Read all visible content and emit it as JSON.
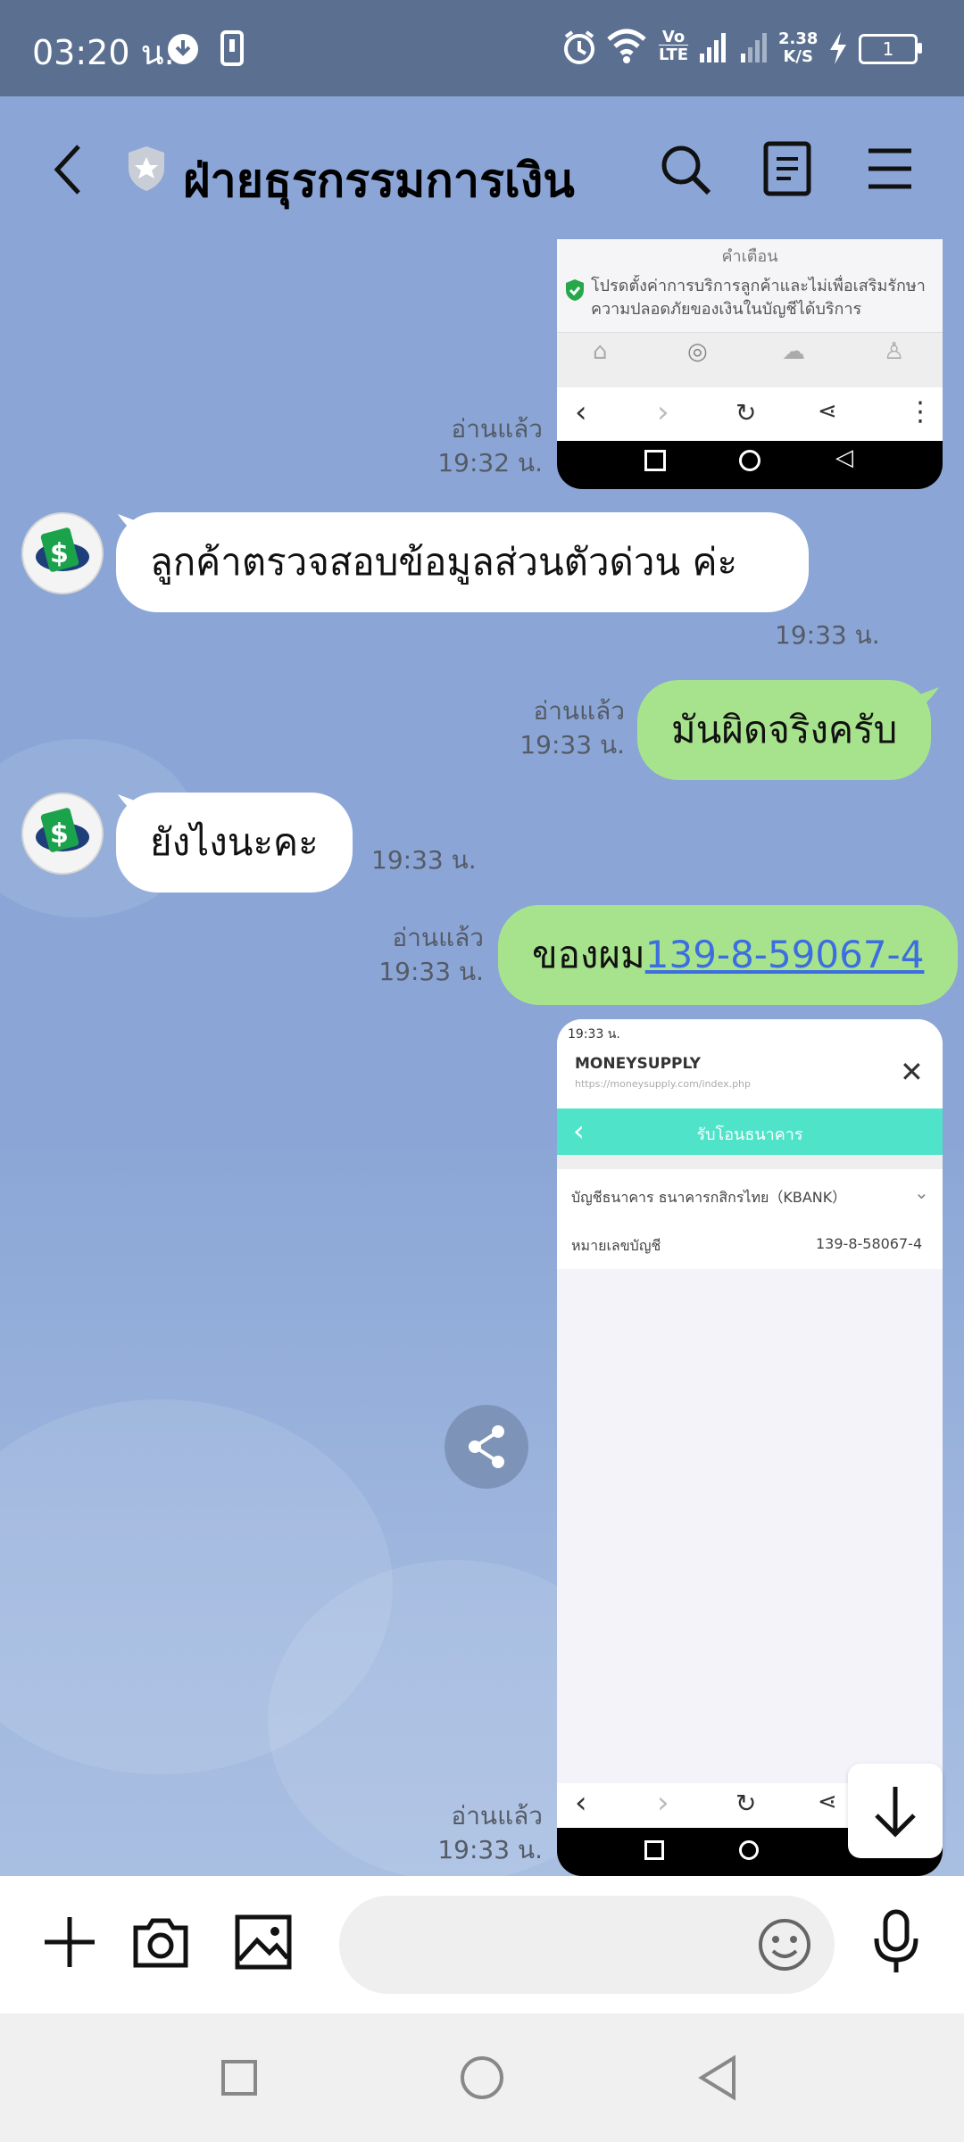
{
  "status_bar": {
    "time": "03:20 น.",
    "speed": "2.38",
    "speed_unit": "K/S",
    "battery": "1",
    "volte_top": "Vo",
    "volte_bottom": "LTE"
  },
  "header": {
    "title": "ฝ่ายธุรกรรมการเงิน"
  },
  "messages": {
    "m1": {
      "read": "อ่านแล้ว",
      "time": "19:32 น."
    },
    "m2": {
      "text": "ลูกค้าตรวจสอบข้อมูลส่วนตัวด่วน ค่ะ",
      "time": "19:33 น."
    },
    "m3": {
      "text": "มันผิดจริงครับ",
      "read": "อ่านแล้ว",
      "time": "19:33 น."
    },
    "m4": {
      "text": "ยังไงนะคะ",
      "time": "19:33 น."
    },
    "m5": {
      "prefix": "ของผม",
      "link": "139-8-59067-4",
      "read": "อ่านแล้ว",
      "time": "19:33 น."
    },
    "m6": {
      "read": "อ่านแล้ว",
      "time": "19:33 น."
    }
  },
  "screenshot1": {
    "notice_title": "คำเตือน",
    "notice_text": "โปรดตั้งค่าการบริการลูกค้าและไม่เพื่อเสริมรักษาความปลอดภัยของเงินในบัญชีได้บริการ"
  },
  "screenshot2": {
    "status": "19:33 น.",
    "app_name": "MONEYSUPPLY",
    "url": "https://moneysupply.com/index.php",
    "bar_title": "รับโอนธนาคาร",
    "row1_label": "บัญชีธนาคาร ธนาคารกสิกรไทย（KBANK）",
    "row2_label": "หมายเลขบัญชี",
    "row2_value": "139-8-58067-4"
  },
  "colors": {
    "incoming": "#ffffff",
    "outgoing": "#a7e38d",
    "link": "#3d6ee0",
    "teal": "#4fe3c9"
  }
}
